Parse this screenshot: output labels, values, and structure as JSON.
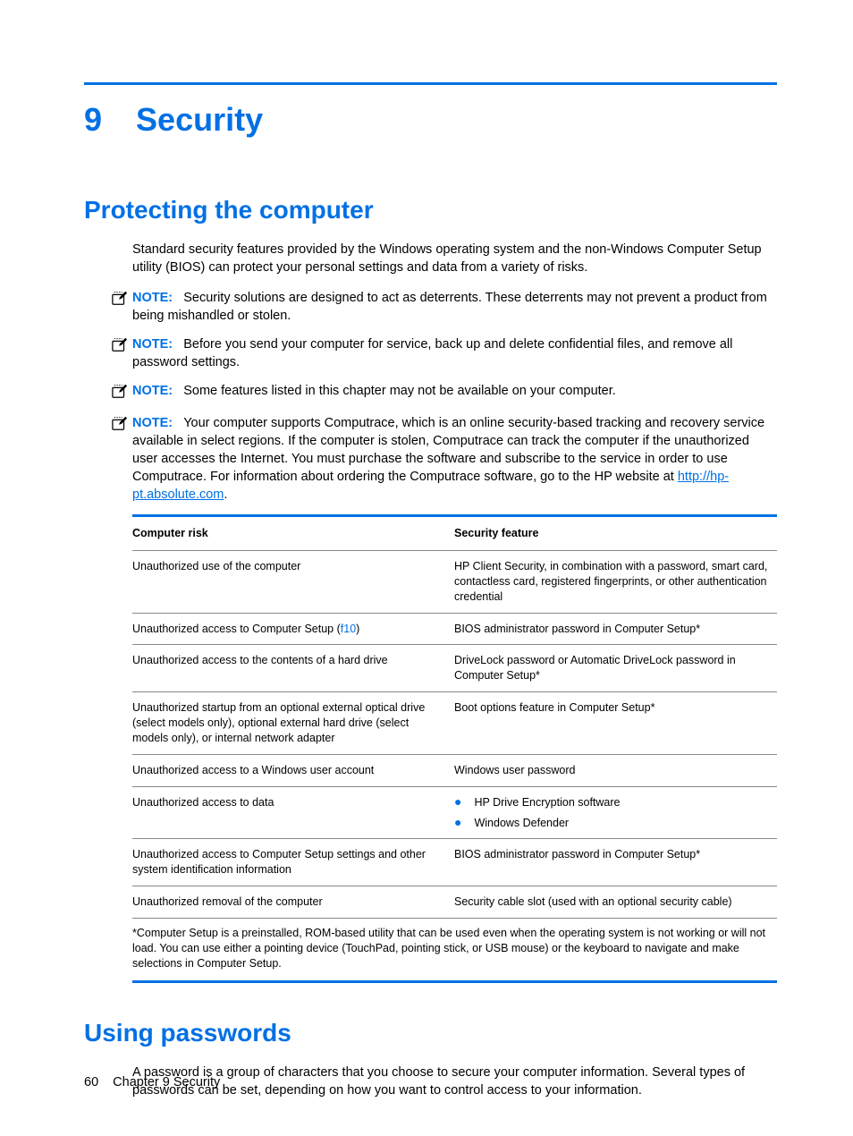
{
  "chapter": {
    "number": "9",
    "title": "Security"
  },
  "section1": {
    "heading": "Protecting the computer",
    "intro": "Standard security features provided by the Windows operating system and the non-Windows Computer Setup utility (BIOS) can protect your personal settings and data from a variety of risks.",
    "notes": [
      {
        "label": "NOTE:",
        "text": "Security solutions are designed to act as deterrents. These deterrents may not prevent a product from being mishandled or stolen."
      },
      {
        "label": "NOTE:",
        "text": "Before you send your computer for service, back up and delete confidential files, and remove all password settings."
      },
      {
        "label": "NOTE:",
        "text": "Some features listed in this chapter may not be available on your computer."
      },
      {
        "label": "NOTE:",
        "text_pre": "Your computer supports Computrace, which is an online security-based tracking and recovery service available in select regions. If the computer is stolen, Computrace can track the computer if the unauthorized user accesses the Internet. You must purchase the software and subscribe to the service in order to use Computrace. For information about ordering the Computrace software, go to the HP website at ",
        "link": "http://hp-pt.absolute.com",
        "text_post": "."
      }
    ]
  },
  "table": {
    "head_risk": "Computer risk",
    "head_feature": "Security feature",
    "rows": [
      {
        "risk": "Unauthorized use of the computer",
        "feature": "HP Client Security, in combination with a password, smart card, contactless card, registered fingerprints, or other authentication credential"
      },
      {
        "risk_pre": "Unauthorized access to Computer Setup (",
        "risk_key": "f10",
        "risk_post": ")",
        "feature": "BIOS administrator password in Computer Setup*"
      },
      {
        "risk": "Unauthorized access to the contents of a hard drive",
        "feature": "DriveLock password or Automatic DriveLock password in Computer Setup*"
      },
      {
        "risk": "Unauthorized startup from an optional external optical drive (select models only), optional external hard drive (select models only), or internal network adapter",
        "feature": "Boot options feature in Computer Setup*"
      },
      {
        "risk": "Unauthorized access to a Windows user account",
        "feature": "Windows user password"
      },
      {
        "risk": "Unauthorized access to data",
        "feature_list": [
          "HP Drive Encryption software",
          "Windows Defender"
        ]
      },
      {
        "risk": "Unauthorized access to Computer Setup settings and other system identification information",
        "feature": "BIOS administrator password in Computer Setup*"
      },
      {
        "risk": "Unauthorized removal of the computer",
        "feature": "Security cable slot (used with an optional security cable)"
      }
    ],
    "footnote": "*Computer Setup is a preinstalled, ROM-based utility that can be used even when the operating system is not working or will not load. You can use either a pointing device (TouchPad, pointing stick, or USB mouse) or the keyboard to navigate and make selections in Computer Setup."
  },
  "section2": {
    "heading": "Using passwords",
    "intro": "A password is a group of characters that you choose to secure your computer information. Several types of passwords can be set, depending on how you want to control access to your information."
  },
  "footer": {
    "page": "60",
    "chapter_label": "Chapter 9   Security"
  }
}
